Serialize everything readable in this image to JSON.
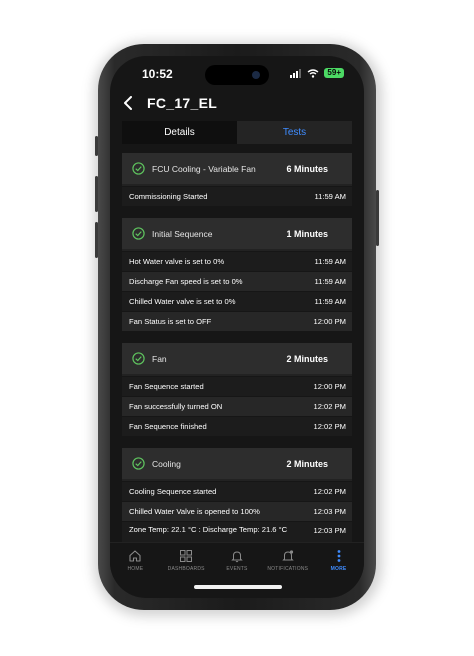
{
  "status_bar": {
    "time": "10:52",
    "battery": "59+"
  },
  "header": {
    "title": "FC_17_EL"
  },
  "tabs": [
    {
      "label": "Details",
      "active": true
    },
    {
      "label": "Tests",
      "active": false
    }
  ],
  "sections": [
    {
      "title": "FCU Cooling - Variable Fan",
      "duration": "6 Minutes",
      "rows": [
        {
          "message": "Commissioning Started",
          "time": "11:59 AM"
        }
      ]
    },
    {
      "title": "Initial Sequence",
      "duration": "1 Minutes",
      "rows": [
        {
          "message": "Hot Water valve is set to 0%",
          "time": "11:59 AM"
        },
        {
          "message": "Discharge Fan speed is set to 0%",
          "time": "11:59 AM"
        },
        {
          "message": "Chilled Water valve is set to 0%",
          "time": "11:59 AM"
        },
        {
          "message": "Fan Status is set to OFF",
          "time": "12:00 PM"
        }
      ]
    },
    {
      "title": "Fan",
      "duration": "2 Minutes",
      "rows": [
        {
          "message": "Fan Sequence started",
          "time": "12:00 PM"
        },
        {
          "message": "Fan successfully turned ON",
          "time": "12:02 PM"
        },
        {
          "message": "Fan Sequence finished",
          "time": "12:02 PM"
        }
      ]
    },
    {
      "title": "Cooling",
      "duration": "2 Minutes",
      "rows": [
        {
          "message": "Cooling Sequence started",
          "time": "12:02 PM"
        },
        {
          "message": "Chilled Water Valve is opened to 100%",
          "time": "12:03 PM"
        },
        {
          "message": "Zone Temp:  22.1 °C  : Discharge Temp: 21.6 °C",
          "time": "12:03 PM"
        }
      ]
    }
  ],
  "bottom_nav": [
    {
      "label": "HOME",
      "icon": "home-icon",
      "active": false
    },
    {
      "label": "DASHBOARDS",
      "icon": "dashboards-icon",
      "active": false
    },
    {
      "label": "EVENTS",
      "icon": "bell-icon",
      "active": false
    },
    {
      "label": "NOTIFICATIONS",
      "icon": "notification-bell-icon",
      "active": false
    },
    {
      "label": "MORE",
      "icon": "more-vertical-icon",
      "active": true
    }
  ],
  "colors": {
    "accent": "#3f8cff",
    "check": "#5fc45f",
    "background": "#161616",
    "section_header": "#2d2d2d"
  }
}
